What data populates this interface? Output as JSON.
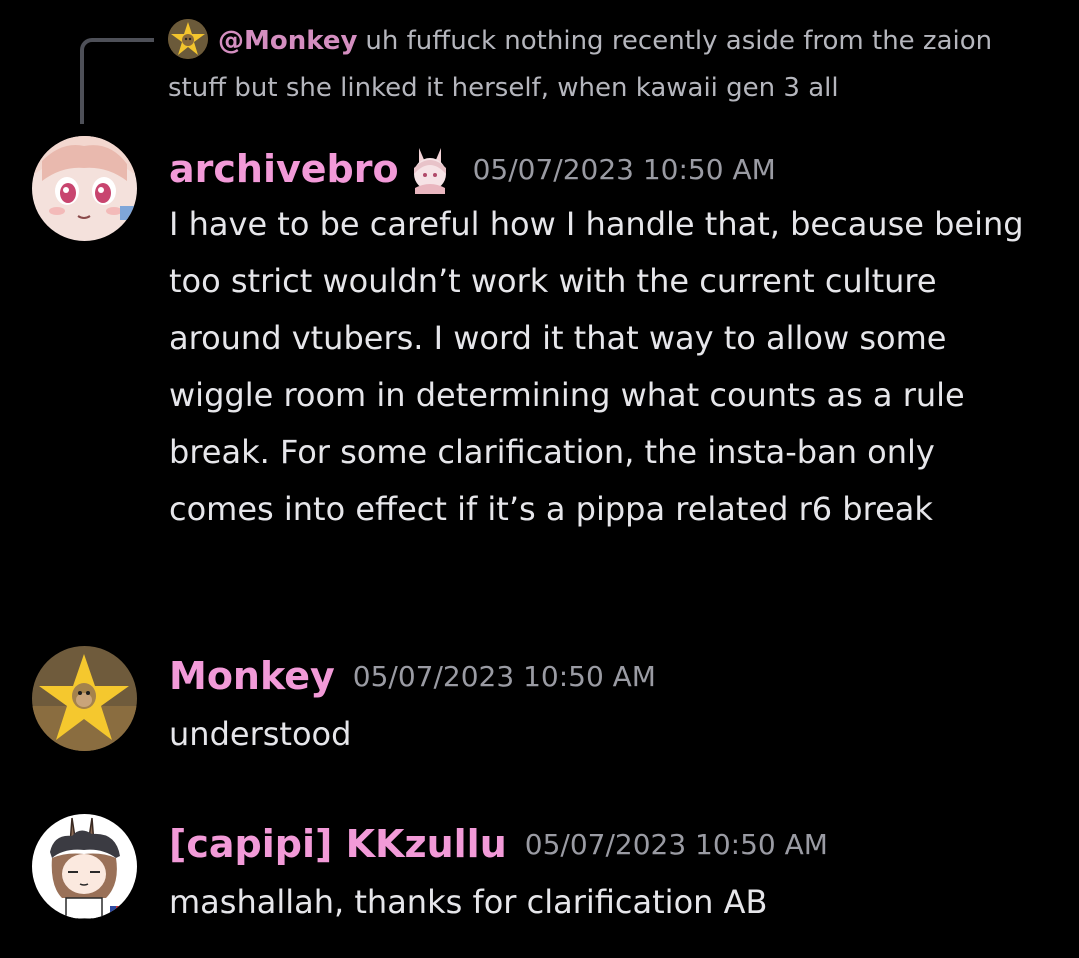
{
  "reply": {
    "mention": "@Monkey",
    "text": "uh fuffuck  nothing recently aside from the zaion stuff but she linked it herself, when kawaii gen 3 all",
    "avatar_icon": "monkey-star-avatar"
  },
  "messages": [
    {
      "username": "archivebro",
      "timestamp": "05/07/2023 10:50 AM",
      "text": "I have to be careful how I handle that, because being too strict wouldn’t work with the current culture around vtubers. I word it that way to allow some wiggle room in determining what counts as a rule break. For some clarification, the insta-ban only comes into effect if it’s a pippa related r6 break",
      "avatar_icon": "anime-girl-avatar",
      "badge_icon": "rabbit-girl-badge"
    },
    {
      "username": "Monkey",
      "timestamp": "05/07/2023 10:50 AM",
      "text": "understood",
      "avatar_icon": "monkey-star-avatar"
    },
    {
      "username": "[capipi] KKzullu",
      "timestamp": "05/07/2023 10:50 AM",
      "text": "mashallah, thanks for clarification AB",
      "avatar_icon": "bunny-ears-girl-avatar"
    }
  ],
  "colors": {
    "background": "#000000",
    "username": "#f29ad8",
    "mention": "#d48ec0",
    "timestamp": "#9a9ba3",
    "text": "#e6e6ea",
    "reply_text": "#b5b6bd"
  }
}
